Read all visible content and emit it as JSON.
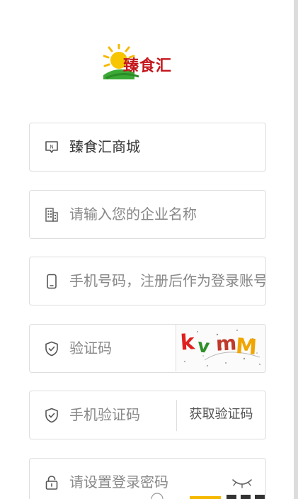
{
  "logo": {
    "text": "臻食汇"
  },
  "form": {
    "store": {
      "value": "臻食汇商城",
      "icon": "store-icon"
    },
    "company": {
      "placeholder": "请输入您的企业名称",
      "icon": "building-icon"
    },
    "phone": {
      "placeholder": "手机号码，注册后作为登录账号",
      "icon": "phone-icon"
    },
    "captcha": {
      "placeholder": "验证码",
      "icon": "shield-icon",
      "image_text": "kvmM"
    },
    "sms_code": {
      "placeholder": "手机验证码",
      "icon": "shield-icon",
      "button_label": "获取验证码"
    },
    "password": {
      "placeholder": "请设置登录密码",
      "icon": "lock-icon",
      "toggle_icon": "eye-closed-icon"
    }
  },
  "colors": {
    "brand_red": "#c4161c",
    "border": "#dedede",
    "placeholder": "#888888",
    "text": "#333333"
  }
}
